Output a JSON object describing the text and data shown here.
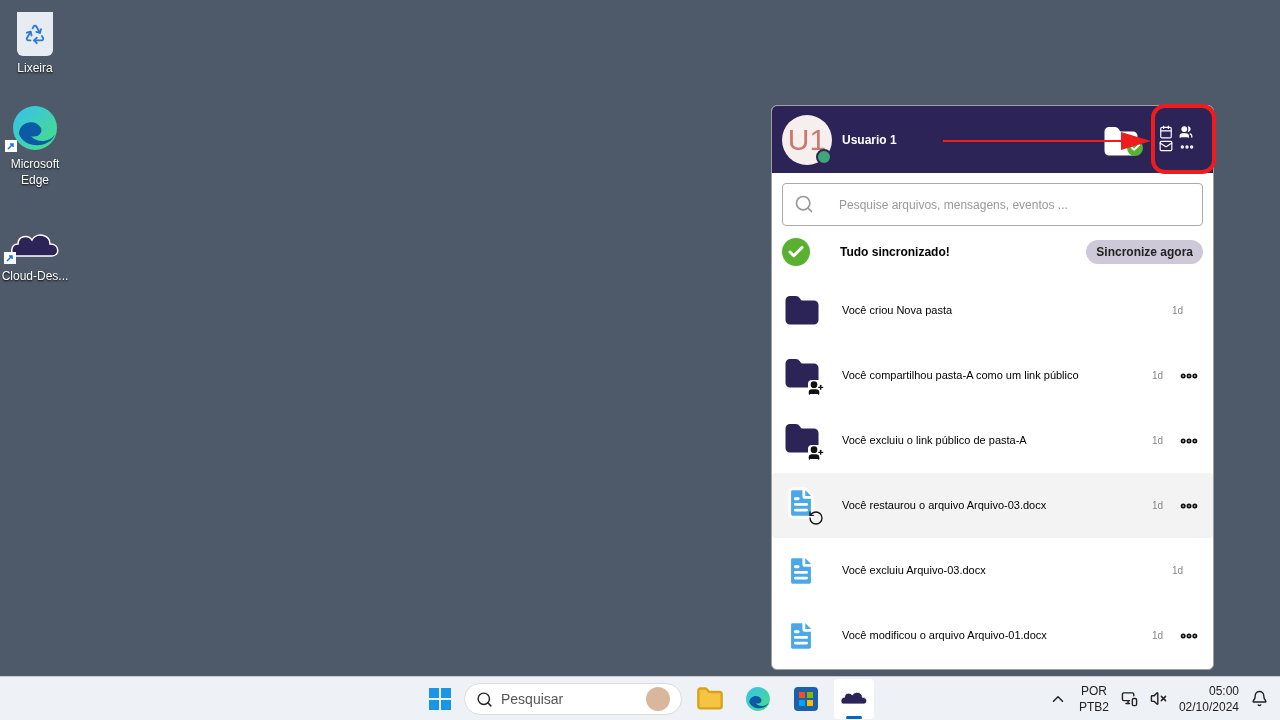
{
  "desktop_icons": [
    {
      "kind": "recycle-bin",
      "label": "Lixeira",
      "shortcut": false
    },
    {
      "kind": "edge",
      "label": "Microsoft Edge",
      "shortcut": true
    },
    {
      "kind": "cloud",
      "label": "Cloud-Des...",
      "shortcut": true
    }
  ],
  "panel": {
    "user": {
      "initials": "U1",
      "name": "Usuario 1",
      "online": true
    },
    "search": {
      "placeholder": "Pesquise arquivos, mensagens, eventos ..."
    },
    "sync": {
      "status": "Tudo sincronizado!",
      "button": "Sincronize agora"
    },
    "activities": [
      {
        "kind": "folder",
        "text": "Você criou Nova pasta",
        "age": "1d",
        "has_menu": false,
        "selected": false
      },
      {
        "kind": "folder-share",
        "text": "Você compartilhou pasta-A como um link público",
        "age": "1d",
        "has_menu": true,
        "selected": false
      },
      {
        "kind": "folder-share",
        "text": "Você excluiu o link público de pasta-A",
        "age": "1d",
        "has_menu": true,
        "selected": false
      },
      {
        "kind": "file-restore",
        "text": "Você restaurou o arquivo Arquivo-03.docx",
        "age": "1d",
        "has_menu": true,
        "selected": true
      },
      {
        "kind": "file",
        "text": "Você excluiu Arquivo-03.docx",
        "age": "1d",
        "has_menu": false,
        "selected": false
      },
      {
        "kind": "file",
        "text": "Você modificou o arquivo Arquivo-01.docx",
        "age": "1d",
        "has_menu": true,
        "selected": false
      }
    ]
  },
  "taskbar": {
    "search_placeholder": "Pesquisar",
    "apps": [
      {
        "kind": "explorer",
        "selected": false
      },
      {
        "kind": "edge",
        "selected": false
      },
      {
        "kind": "store",
        "selected": false
      },
      {
        "kind": "cloud",
        "selected": true
      }
    ],
    "language": "POR",
    "layout": "PTB2",
    "time": "05:00",
    "date": "02/10/2024"
  }
}
